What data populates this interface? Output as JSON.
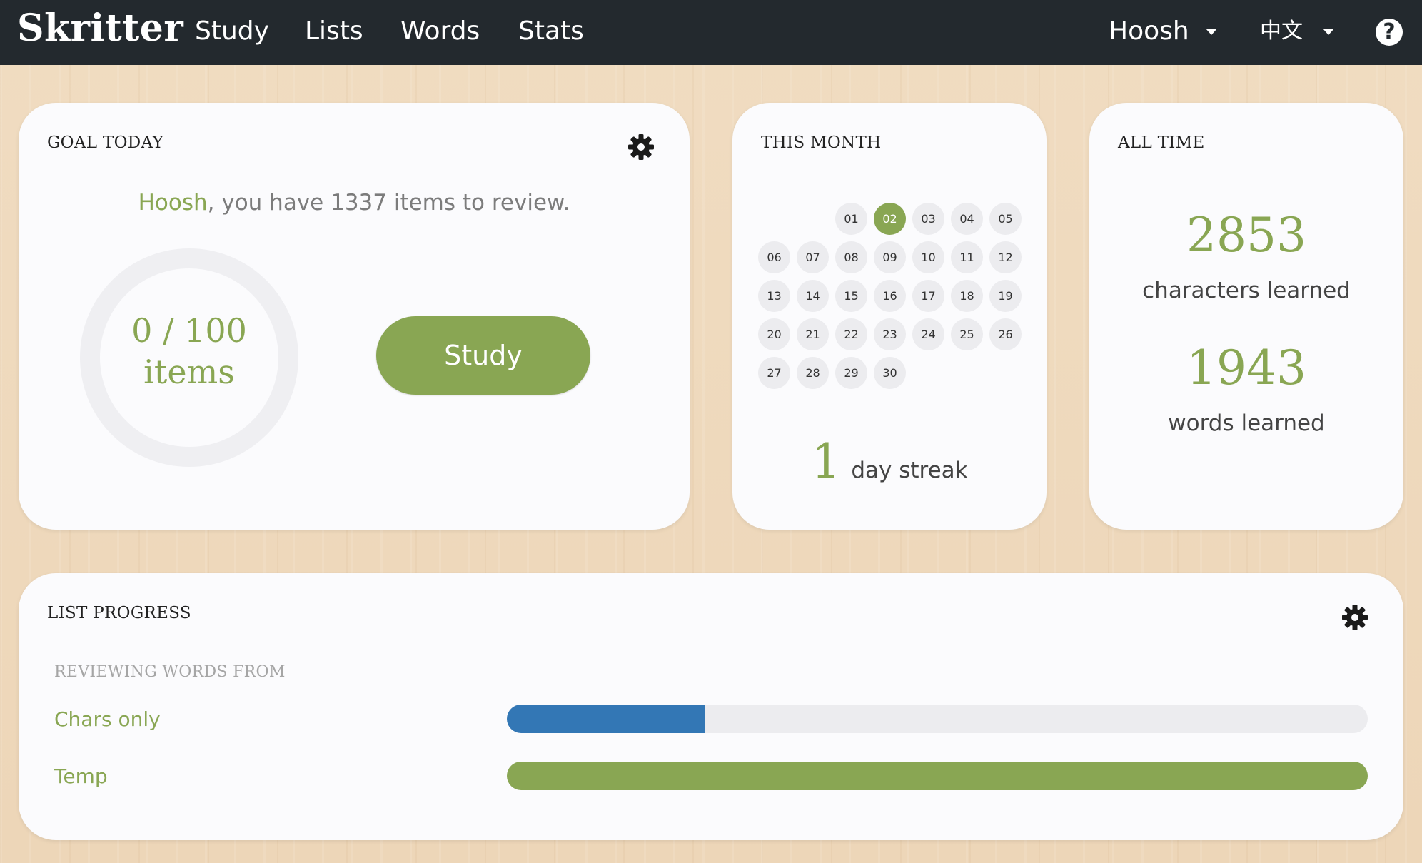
{
  "nav": {
    "brand": "Skritter",
    "items": [
      "Study",
      "Lists",
      "Words",
      "Stats"
    ],
    "user": "Hoosh",
    "language": "中文",
    "help_icon": "question-circle-icon"
  },
  "goal": {
    "title": "GOAL TODAY",
    "username": "Hoosh",
    "review_text": ", you have 1337 items to review.",
    "progress_fraction": "0 / 100",
    "progress_unit": "items",
    "progress_value": 0,
    "study_button": "Study"
  },
  "month": {
    "title": "THIS MONTH",
    "days": [
      "01",
      "02",
      "03",
      "04",
      "05",
      "06",
      "07",
      "08",
      "09",
      "10",
      "11",
      "12",
      "13",
      "14",
      "15",
      "16",
      "17",
      "18",
      "19",
      "20",
      "21",
      "22",
      "23",
      "24",
      "25",
      "26",
      "27",
      "28",
      "29",
      "30"
    ],
    "first_weekday_index": 2,
    "active_days": [
      "02"
    ],
    "streak_count": "1",
    "streak_label": "day streak"
  },
  "alltime": {
    "title": "ALL TIME",
    "characters_count": "2853",
    "characters_label": "characters learned",
    "words_count": "1943",
    "words_label": "words learned"
  },
  "list_progress": {
    "title": "LIST PROGRESS",
    "subtitle": "REVIEWING WORDS FROM",
    "lists": [
      {
        "name": "Chars only",
        "progress": 0.23,
        "color": "#3377b5"
      },
      {
        "name": "Temp",
        "progress": 1.0,
        "color": "#89a653"
      }
    ]
  },
  "colors": {
    "accent_green": "#89a653",
    "accent_blue": "#3377b5",
    "topbar": "#23292e"
  }
}
